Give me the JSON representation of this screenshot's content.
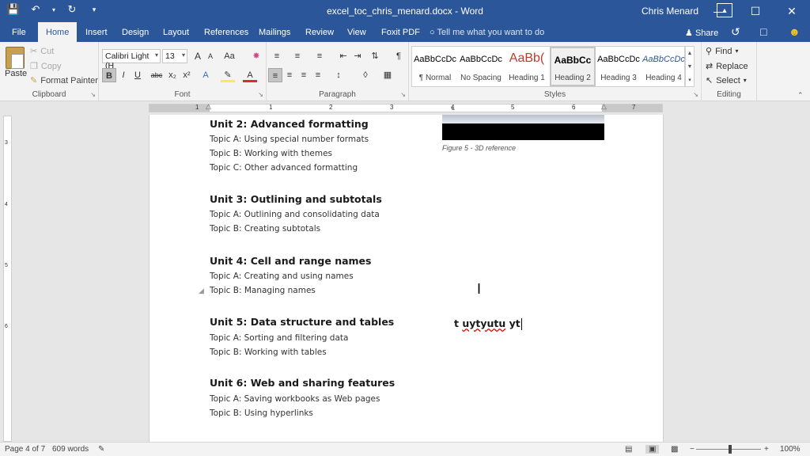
{
  "app": {
    "doc_title": "excel_toc_chris_menard.docx",
    "title_sep": " - ",
    "app_name": "Word",
    "user": "Chris Menard"
  },
  "qat": {
    "save_icon": "save-icon",
    "undo_icon": "undo-icon",
    "redo_icon": "redo-icon"
  },
  "tabs": [
    "File",
    "Home",
    "Insert",
    "Design",
    "Layout",
    "References",
    "Mailings",
    "Review",
    "View",
    "Foxit PDF"
  ],
  "tell_me": "Tell me what you want to do",
  "share_label": "Share",
  "ribbon": {
    "clipboard": {
      "paste": "Paste",
      "cut": "Cut",
      "copy": "Copy",
      "format_painter": "Format Painter",
      "label": "Clipboard"
    },
    "font": {
      "name": "Calibri Light (H",
      "size": "13",
      "label": "Font",
      "bold": "B",
      "italic": "I",
      "underline": "U",
      "strike": "abc",
      "sub": "x₂",
      "sup": "x²",
      "grow": "A",
      "shrink": "A",
      "case": "Aa"
    },
    "paragraph": {
      "label": "Paragraph",
      "pilcrow": "¶"
    },
    "styles": {
      "label": "Styles",
      "items": [
        {
          "sample": "AaBbCcDc",
          "name": "¶ Normal"
        },
        {
          "sample": "AaBbCcDc",
          "name": "No Spacing"
        },
        {
          "sample": "AaBb(",
          "name": "Heading 1"
        },
        {
          "sample": "AaBbCc",
          "name": "Heading 2"
        },
        {
          "sample": "AaBbCcDc",
          "name": "Heading 3"
        },
        {
          "sample": "AaBbCcDc",
          "name": "Heading 4"
        }
      ]
    },
    "editing": {
      "find": "Find",
      "replace": "Replace",
      "select": "Select",
      "label": "Editing"
    }
  },
  "ruler_numbers": [
    "1",
    "1",
    "2",
    "3",
    "4",
    "5",
    "6",
    "7"
  ],
  "vruler_numbers": [
    "3",
    "4",
    "5",
    "6"
  ],
  "document": {
    "units": [
      {
        "title": "Unit 2: Advanced formatting",
        "topics": [
          "Topic A: Using special number formats",
          "Topic B: Working with themes",
          "Topic C: Other advanced formatting"
        ]
      },
      {
        "title": "Unit 3: Outlining and subtotals",
        "topics": [
          "Topic A: Outlining and consolidating data",
          "Topic B: Creating subtotals"
        ]
      },
      {
        "title": "Unit 4: Cell and range names",
        "topics": [
          "Topic A: Creating and using names",
          "Topic B: Managing names"
        ]
      },
      {
        "title": "Unit 5: Data structure and tables",
        "topics": [
          "Topic A: Sorting and filtering data",
          "Topic B: Working with tables"
        ]
      },
      {
        "title": "Unit 6: Web and sharing features",
        "topics": [
          "Topic A: Saving workbooks as Web pages",
          "Topic B: Using hyperlinks"
        ]
      }
    ],
    "figure_caption": "Figure 5 - 3D reference",
    "typed_prefix": "t ",
    "typed_squiggle": "uytyutu",
    "typed_suffix": " yt"
  },
  "status": {
    "page": "Page 4 of 7",
    "words": "609 words",
    "zoom": "100%"
  },
  "colors": {
    "accent": "#2b579a"
  }
}
